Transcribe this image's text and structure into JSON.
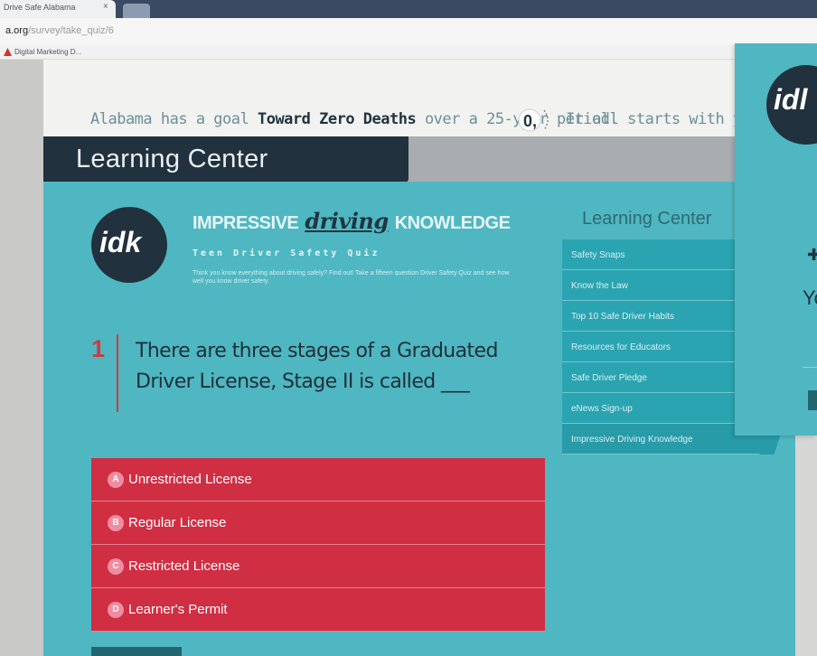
{
  "browser": {
    "tab_title": "Drive Safe Alabama",
    "tab_close": "×",
    "url_domain": "a.org",
    "url_path": "/survey/take_quiz/6",
    "bookmark_label": "Digital Marketing D..."
  },
  "banner": {
    "tagline_pre": "Alabama has a goal ",
    "tagline_bold": "Toward Zero Deaths",
    "tagline_post": " over a 25-year period.",
    "tagline_end": "It all starts with you!",
    "logo_text": "0,"
  },
  "header": {
    "title": "Learning Center"
  },
  "quiz": {
    "logo_text": "idk",
    "brand_pre": "IMPRESSIVE",
    "brand_mid": "driving",
    "brand_post": "KNOWLEDGE",
    "subtitle": "Teen Driver Safety Quiz",
    "description": "Think you know everything about driving safely? Find out! Take a fifteen question Driver Safety Quiz and see how well you know driver safety.",
    "question_number": "1",
    "question_text": "There are three stages of a Graduated Driver License, Stage II is called ___",
    "answers": [
      {
        "letter": "A",
        "label": "Unrestricted License"
      },
      {
        "letter": "B",
        "label": "Regular License"
      },
      {
        "letter": "C",
        "label": "Restricted License"
      },
      {
        "letter": "D",
        "label": "Learner's Permit"
      }
    ]
  },
  "sidebar": {
    "title": "Learning Center",
    "items": [
      {
        "label": "Safety Snaps"
      },
      {
        "label": "Know the Law"
      },
      {
        "label": "Top 10 Safe Driver Habits"
      },
      {
        "label": "Resources for Educators"
      },
      {
        "label": "Safe Driver Pledge"
      },
      {
        "label": "eNews Sign-up"
      },
      {
        "label": "Impressive Driving Knowledge"
      }
    ]
  },
  "popup": {
    "logo_text": "idl",
    "glyph": "✚",
    "text": "Yo"
  },
  "colors": {
    "teal": "#4fb7c1",
    "navy": "#21313d",
    "answer_red": "#d02e43",
    "sidebar_teal": "#2ba4b1"
  }
}
